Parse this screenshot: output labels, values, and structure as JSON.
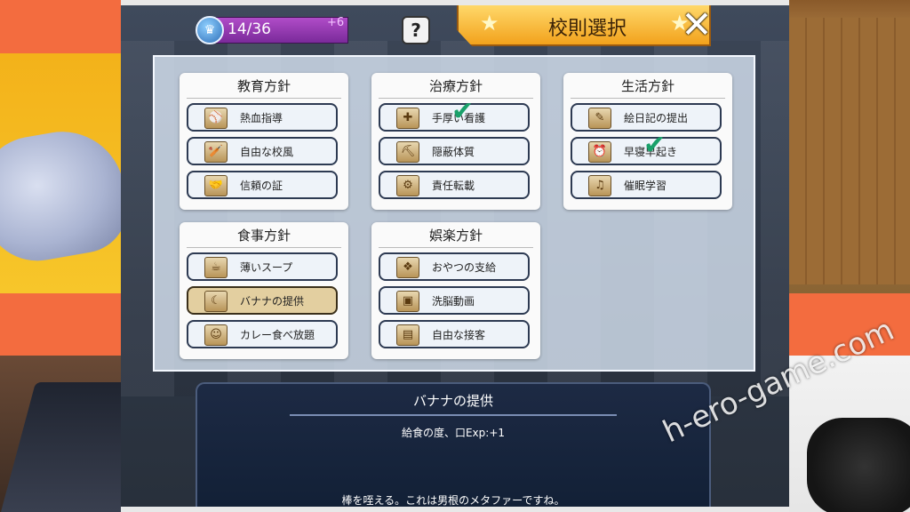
{
  "header": {
    "rank_value": "14/36",
    "rank_bonus": "+6",
    "help_label": "?",
    "title": "校則選択",
    "close_label": "✕"
  },
  "categories": [
    {
      "title": "教育方針",
      "options": [
        {
          "label": "熱血指導",
          "icon": "baseball-icon",
          "glyph": "⚾"
        },
        {
          "label": "自由な校風",
          "icon": "bat-icon",
          "glyph": "🏏"
        },
        {
          "label": "信頼の証",
          "icon": "handshake-icon",
          "glyph": "🤝"
        }
      ]
    },
    {
      "title": "治療方針",
      "options": [
        {
          "label": "手厚い看護",
          "icon": "medkit-icon",
          "glyph": "✚",
          "checked": true
        },
        {
          "label": "隠蔽体質",
          "icon": "shovel-icon",
          "glyph": "⛏"
        },
        {
          "label": "責任転載",
          "icon": "gun-icon",
          "glyph": "⚙"
        }
      ]
    },
    {
      "title": "生活方針",
      "options": [
        {
          "label": "絵日記の提出",
          "icon": "bag-icon",
          "glyph": "✎"
        },
        {
          "label": "早寝早起き",
          "icon": "horn-icon",
          "glyph": "⏰",
          "checked": true
        },
        {
          "label": "催眠学習",
          "icon": "gramophone-icon",
          "glyph": "♫"
        }
      ]
    },
    {
      "title": "食事方針",
      "options": [
        {
          "label": "薄いスープ",
          "icon": "scroll-icon",
          "glyph": "☕"
        },
        {
          "label": "バナナの提供",
          "icon": "banana-icon",
          "glyph": "☾",
          "selected": true
        },
        {
          "label": "カレー食べ放題",
          "icon": "mask-icon",
          "glyph": "☺"
        }
      ]
    },
    {
      "title": "娯楽方針",
      "options": [
        {
          "label": "おやつの支給",
          "icon": "candy-icon",
          "glyph": "❖"
        },
        {
          "label": "洗脳動画",
          "icon": "projector-icon",
          "glyph": "▣"
        },
        {
          "label": "自由な接客",
          "icon": "register-icon",
          "glyph": "▤"
        }
      ]
    }
  ],
  "description": {
    "title": "バナナの提供",
    "effect": "給食の度、口Exp:+1",
    "flavor": "棒を咥える。これは男根のメタファーですね。"
  },
  "watermark": "h-ero-game.com",
  "colors": {
    "check": "#1aa06a",
    "selected_option": "#e3cfa0",
    "title_banner": "#f2a21c"
  }
}
